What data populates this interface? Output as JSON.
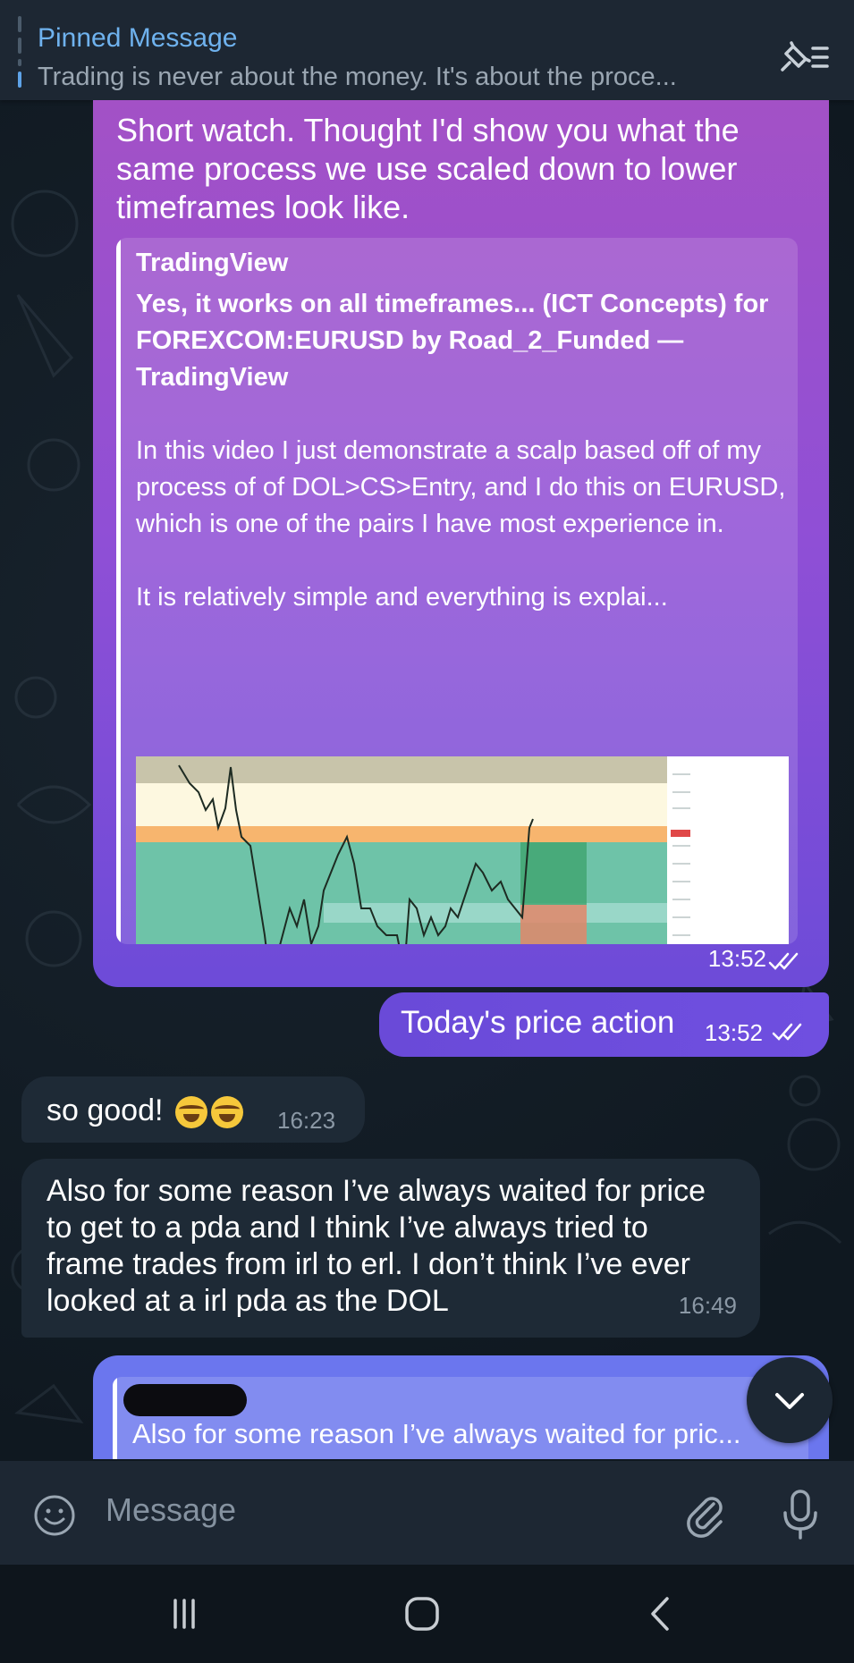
{
  "pinned": {
    "title": "Pinned Message",
    "text": "Trading is never about the money. It's about the proce...",
    "list_icon": "pinned-list-icon"
  },
  "messages": {
    "outgoing_1": {
      "text": "Short watch. Thought I'd show you what the same process we use scaled down to lower timeframes look like.",
      "preview": {
        "site": "TradingView",
        "title": "Yes, it works on all timeframes... (ICT Concepts) for FOREXCOM:EURUSD by Road_2_Funded — TradingView",
        "description": "In this video I just demonstrate a scalp based off of my process of of DOL>CS>Entry, and I do this on EURUSD, which is one of the pairs I have most experience in.\n\nIt is relatively simple and everything is explai..."
      },
      "time": "13:52"
    },
    "outgoing_2": {
      "text": "Today's price action",
      "time": "13:52"
    },
    "incoming_1": {
      "text": "so good!",
      "time": "16:23"
    },
    "incoming_2": {
      "text": "Also for some reason I’ve always waited for price to get to a pda and I think I’ve always tried to frame trades from irl to erl. I don’t think I’ve ever looked at a irl pda as the DOL",
      "time": "16:49"
    },
    "outgoing_reply": {
      "quoted_text": "Also for some reason I’ve always waited for pric..."
    }
  },
  "input": {
    "placeholder": "Message"
  },
  "colors": {
    "accent_blue": "#6fb2ee",
    "bubble_out_top": "#a351c6",
    "bubble_out_bottom": "#6d4bd8",
    "bubble_in": "#1e2a36",
    "header_bg": "#1d2733"
  },
  "icons": [
    "pinned-list-icon",
    "double-check-icon",
    "chevron-down-icon",
    "smile-icon",
    "paperclip-icon",
    "microphone-icon",
    "recent-apps-icon",
    "home-icon",
    "back-icon"
  ]
}
